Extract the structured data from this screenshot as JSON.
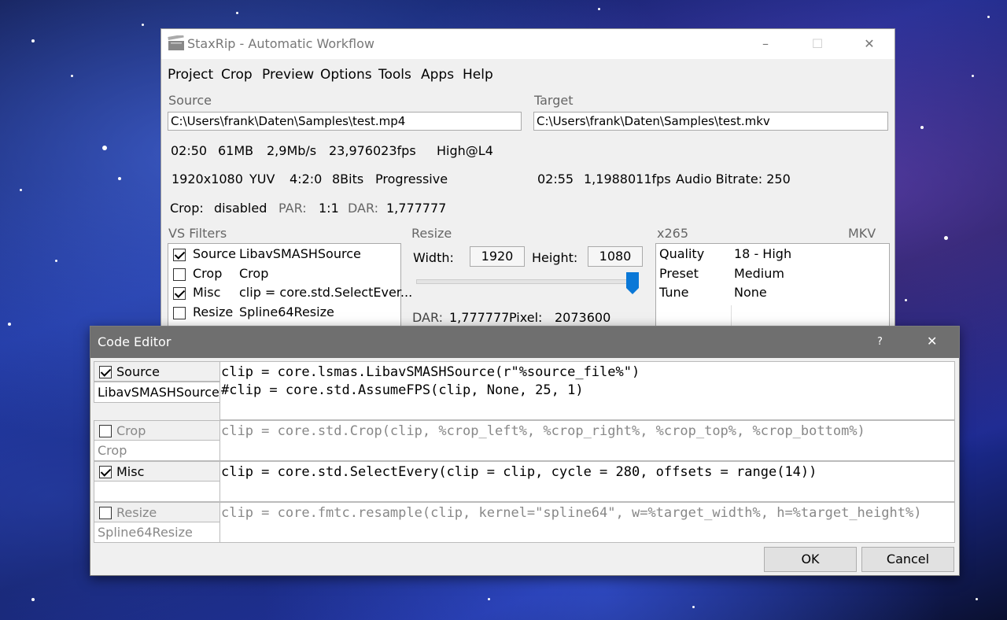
{
  "main_window": {
    "title": "StaxRip - Automatic Workflow",
    "menu": [
      "Project",
      "Crop",
      "Preview",
      "Options",
      "Tools",
      "Apps",
      "Help"
    ],
    "source": {
      "label": "Source",
      "path": "C:\\Users\\frank\\Daten\\Samples\\test.mp4",
      "duration": "02:50",
      "size": "61MB",
      "bitrate": "2,9Mb/s",
      "fps": "23,976023fps",
      "profile": "High@L4",
      "resolution": "1920x1080",
      "colorspace": "YUV",
      "chroma": "4:2:0",
      "bits": "8Bits",
      "scan": "Progressive",
      "crop_label": "Crop:",
      "crop_value": "disabled",
      "par_label": "PAR:",
      "par_value": "1:1",
      "dar_label": "DAR:",
      "dar_value": "1,777777"
    },
    "target": {
      "label": "Target",
      "path": "C:\\Users\\frank\\Daten\\Samples\\test.mkv",
      "duration": "02:55",
      "fps": "1,1988011fps",
      "audio_bitrate": "Audio Bitrate: 250"
    },
    "vs_filters": {
      "label": "VS Filters",
      "rows": [
        {
          "checked": true,
          "name": "Source",
          "value": "LibavSMASHSource"
        },
        {
          "checked": false,
          "name": "Crop",
          "value": "Crop"
        },
        {
          "checked": true,
          "name": "Misc",
          "value": "clip = core.std.SelectEver..."
        },
        {
          "checked": false,
          "name": "Resize",
          "value": "Spline64Resize"
        }
      ]
    },
    "resize": {
      "label": "Resize",
      "width_label": "Width:",
      "width_value": "1920",
      "height_label": "Height:",
      "height_value": "1080",
      "dar_label": "DAR:",
      "dar_value": "1,777777",
      "pixel_label": "Pixel:",
      "pixel_value": "2073600"
    },
    "encoder": {
      "label": "x265",
      "container": "MKV",
      "rows": [
        {
          "name": "Quality",
          "value": "18 - High"
        },
        {
          "name": "Preset",
          "value": "Medium"
        },
        {
          "name": "Tune",
          "value": "None"
        }
      ]
    }
  },
  "code_editor": {
    "title": "Code Editor",
    "help": "?",
    "close": "✕",
    "filters": [
      {
        "checked": true,
        "name": "Source",
        "sub": "LibavSMASHSource",
        "enabled": true,
        "code": "clip = core.lsmas.LibavSMASHSource(r\"%source_file%\")\n#clip = core.std.AssumeFPS(clip, None, 25, 1)"
      },
      {
        "checked": false,
        "name": "Crop",
        "sub": "Crop",
        "enabled": false,
        "code": "clip = core.std.Crop(clip, %crop_left%, %crop_right%, %crop_top%, %crop_bottom%)"
      },
      {
        "checked": true,
        "name": "Misc",
        "sub": "",
        "enabled": true,
        "code": "clip = core.std.SelectEvery(clip = clip, cycle = 280, offsets = range(14))"
      },
      {
        "checked": false,
        "name": "Resize",
        "sub": "Spline64Resize",
        "enabled": false,
        "code": "clip = core.fmtc.resample(clip, kernel=\"spline64\", w=%target_width%, h=%target_height%)"
      }
    ],
    "ok_label": "OK",
    "cancel_label": "Cancel"
  }
}
